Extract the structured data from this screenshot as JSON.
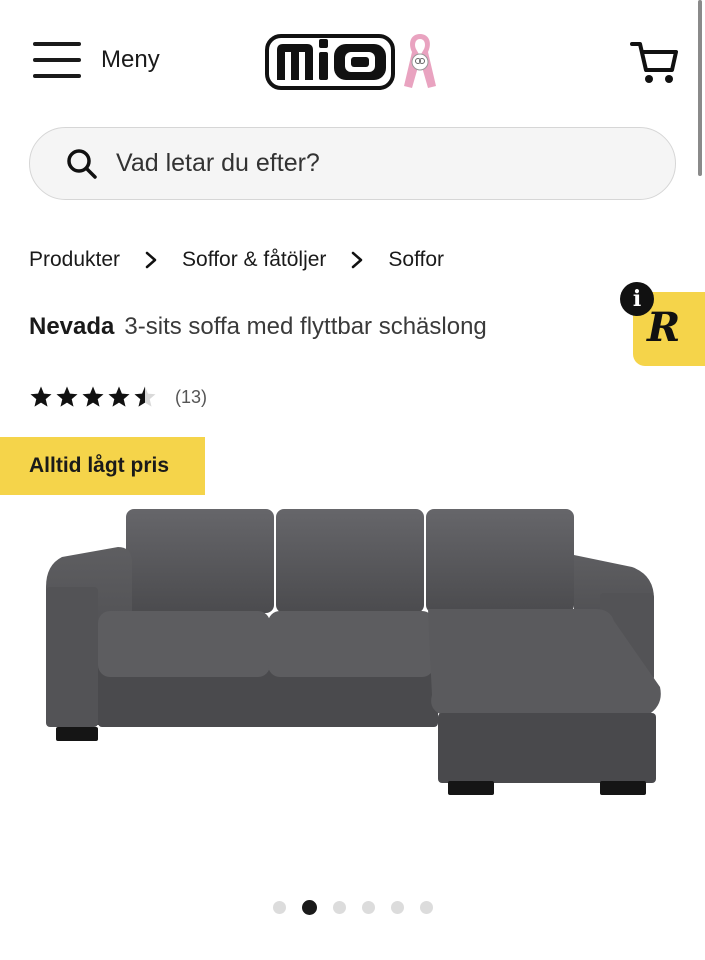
{
  "header": {
    "menu_label": "Meny",
    "logo_text": "mio",
    "icons": [
      "hamburger-icon",
      "pink-ribbon-icon",
      "cart-icon"
    ]
  },
  "search": {
    "placeholder": "Vad letar du efter?"
  },
  "breadcrumb": {
    "items": [
      "Produkter",
      "Soffor & fåtöljer",
      "Soffor"
    ]
  },
  "product": {
    "brand": "Nevada",
    "description": "3-sits soffa med flyttbar schäslong",
    "rating": 4.5,
    "rating_max": 5,
    "review_count": "(13)",
    "badge": "Alltid lågt pris"
  },
  "widget": {
    "letter": "R",
    "info": "i"
  },
  "carousel": {
    "total": 6,
    "active_index": 1
  },
  "colors": {
    "accent_yellow": "#f5d44a",
    "text": "#1a1a1a",
    "sofa_grey": "#5a5a5c",
    "ribbon_pink": "#e9a3c0"
  }
}
